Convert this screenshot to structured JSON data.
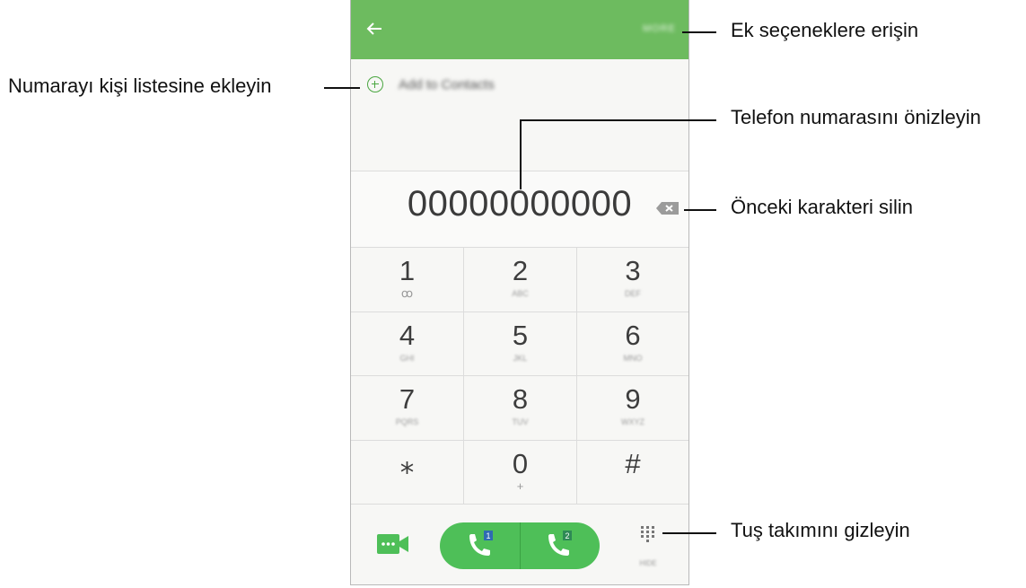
{
  "header": {
    "more_label": "MORE"
  },
  "add_contact": {
    "label": "Add to Contacts"
  },
  "display": {
    "number": "00000000000"
  },
  "keys": [
    {
      "digit": "1",
      "sub": "ꝏ"
    },
    {
      "digit": "2",
      "sub": "ABC"
    },
    {
      "digit": "3",
      "sub": "DEF"
    },
    {
      "digit": "4",
      "sub": "GHI"
    },
    {
      "digit": "5",
      "sub": "JKL"
    },
    {
      "digit": "6",
      "sub": "MNO"
    },
    {
      "digit": "7",
      "sub": "PQRS"
    },
    {
      "digit": "8",
      "sub": "TUV"
    },
    {
      "digit": "9",
      "sub": "WXYZ"
    },
    {
      "digit": "⁎",
      "sub": ""
    },
    {
      "digit": "0",
      "sub": "+"
    },
    {
      "digit": "#",
      "sub": ""
    }
  ],
  "call_buttons": [
    {
      "sim": "1"
    },
    {
      "sim": "2"
    }
  ],
  "keypad_toggle_label": "HIDE",
  "annotations": {
    "more_options": "Ek seçeneklere erişin",
    "add_contacts": "Numarayı kişi listesine ekleyin",
    "preview_number": "Telefon numarasını önizleyin",
    "delete_char": "Önceki karakteri silin",
    "hide_keypad": "Tuş takımını gizleyin"
  },
  "colors": {
    "accent": "#6dbb5f",
    "call": "#4ebf58"
  }
}
